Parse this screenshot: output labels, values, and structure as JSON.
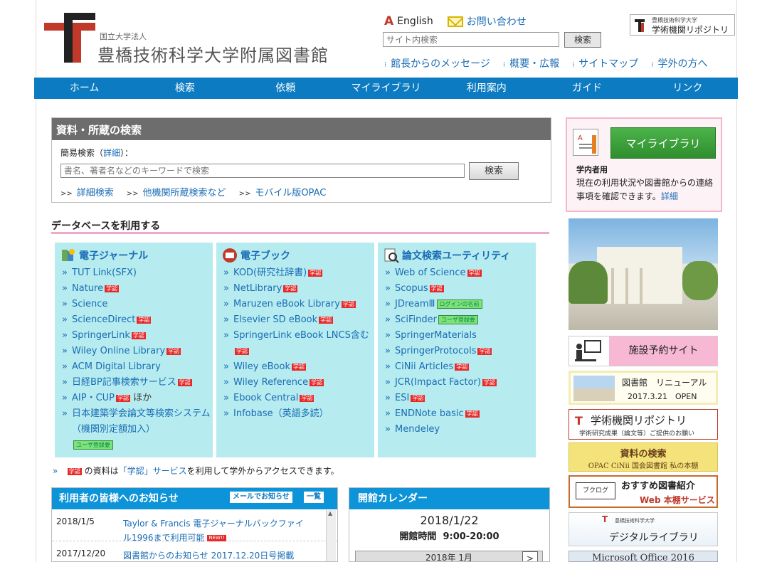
{
  "header": {
    "org_small": "国立大学法人",
    "org_title": "豊橋技術科学大学附属図書館",
    "english_label": "English",
    "contact_label": "お問い合わせ",
    "site_search_placeholder": "サイト内検索",
    "site_search_button": "検索",
    "repo_small": "豊橋技術科学大学",
    "repo_label": "学術機関リポジトリ",
    "sub_links": [
      "館長からのメッセージ",
      "概要・広報",
      "サイトマップ",
      "学外の方へ"
    ]
  },
  "nav": [
    "ホーム",
    "検索",
    "依頼",
    "マイライブラリ",
    "利用案内",
    "ガイド",
    "リンク"
  ],
  "search": {
    "title": "資料・所蔵の検索",
    "label_prefix": "簡易検索（",
    "label_link": "詳細",
    "label_suffix": "）：",
    "input_placeholder": "書名、著者名などのキーワードで検索",
    "button": "検索",
    "links": [
      "詳細検索",
      "他機関所蔵検索など",
      "モバイル版OPAC"
    ],
    "link_prefix": ">>"
  },
  "database": {
    "heading": "データベースを利用する",
    "gakunin_badge": "学認",
    "user_reg_tag": "ユーザ登録要",
    "login_tag": "ログインの名前",
    "columns": [
      {
        "title": "電子ジャーナル",
        "items": [
          "TUT Link(SFX)",
          "Nature",
          "Science",
          "ScienceDirect",
          "SpringerLink",
          "Wiley Online Library",
          "ACM Digital Library",
          "日経BP記事検索サービス",
          "AIP・CUP",
          "日本建築学会論文等検索システム（機関別定額加入）"
        ],
        "hoka": "ほか"
      },
      {
        "title": "電子ブック",
        "items": [
          "KOD(研究社辞書)",
          "NetLibrary",
          "Maruzen eBook Library",
          "Elsevier SD eBook",
          "SpringerLink eBook LNCS含む",
          "Wiley eBook",
          "Wiley Reference",
          "Ebook Central",
          "Infobase（英語多読）"
        ]
      },
      {
        "title": "論文検索ユーティリティ",
        "items": [
          "Web of Science",
          "Scopus",
          "JDreamⅢ",
          "SciFinder",
          "SpringerMaterials",
          "SpringerProtocols",
          "CiNii Articles",
          "JCR(Impact Factor)",
          "ESI",
          "ENDNote basic",
          "Mendeley"
        ]
      }
    ],
    "note_prefix": "の資料は",
    "note_link": "「学認」サービス",
    "note_suffix": "を利用して学外からアクセスできます。"
  },
  "notices": {
    "title": "利用者の皆様へのお知らせ",
    "mail_button": "メールでお知らせ",
    "list_button": "一覧",
    "new_badge": "NEW!!",
    "items": [
      {
        "date": "2018/1/5",
        "text": "Taylor & Francis 電子ジャーナルバックファイル1996まで利用可能"
      },
      {
        "date": "2017/12/20",
        "text": "図書館からのお知らせ 2017.12.20日号掲載"
      }
    ]
  },
  "calendar": {
    "title": "開館カレンダー",
    "date": "2018/1/22",
    "hours_label": "開館時間",
    "hours": "9:00-20:00",
    "month": "2018年 1月",
    "next": ">"
  },
  "sidebar": {
    "mylib_button": "マイライブラリ",
    "mylib_sub": "学内者用",
    "mylib_desc": "現在の利用状況や図書館からの連絡事項を確認できます。",
    "mylib_link": "詳細",
    "facility": "施設予約サイト",
    "renewal_l1": "図書館　リニューアル",
    "renewal_l2": "2017.3.21　OPEN",
    "repo_l1": "学術機関リポジトリ",
    "repo_l2": "学術研究成果（論文等）ご提供のお願い",
    "search_l1": "資料の検索",
    "search_l2": "OPAC CiNii 国会図書館 私の本棚",
    "rec_icon": "ブクログ",
    "rec_l1": "おすすめ図書紹介",
    "rec_l2": "Web 本棚サービス",
    "digital_small": "豊橋技術科学大学",
    "digital_l1": "デジタルライブラリ",
    "office": "Microsoft Office 2016"
  },
  "colors": {
    "nav_blue": "#0c7bc1",
    "db_cyan": "#b6ecf0",
    "link_blue": "#1a6cb5",
    "brand_red": "#c0392b"
  }
}
